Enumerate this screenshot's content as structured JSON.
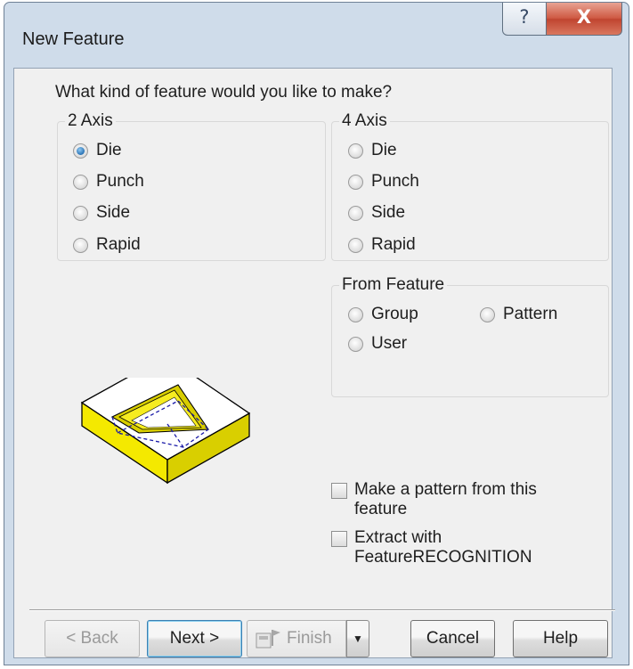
{
  "window": {
    "title": "New Feature",
    "help_glyph": "?",
    "close_glyph": "X"
  },
  "question": "What kind of feature would you like to make?",
  "axis2": {
    "legend": "2 Axis",
    "options": [
      "Die",
      "Punch",
      "Side",
      "Rapid"
    ],
    "selected": "Die"
  },
  "axis4": {
    "legend": "4 Axis",
    "options": [
      "Die",
      "Punch",
      "Side",
      "Rapid"
    ],
    "selected": null
  },
  "from_feature": {
    "legend": "From Feature",
    "group_label": "Group",
    "pattern_label": "Pattern",
    "user_label": "User"
  },
  "checkboxes": {
    "make_pattern_line1": "Make a pattern from this",
    "make_pattern_line2": "feature",
    "make_pattern_checked": false,
    "extract_line1": "Extract with",
    "extract_line2": "FeatureRECOGNITION",
    "extract_checked": false
  },
  "buttons": {
    "back": "< Back",
    "next": "Next >",
    "finish": "Finish",
    "cancel": "Cancel",
    "help": "Help"
  },
  "icons": {
    "help": "question-icon",
    "close": "close-icon",
    "finish": "finish-flag-icon",
    "dropdown": "chevron-down-icon",
    "preview": "pocket-feature-illustration"
  },
  "colors": {
    "window_frame": "#cfdcea",
    "client_bg": "#f0f0f0",
    "close_button": "#c94a35",
    "part_yellow": "#f2e800"
  }
}
